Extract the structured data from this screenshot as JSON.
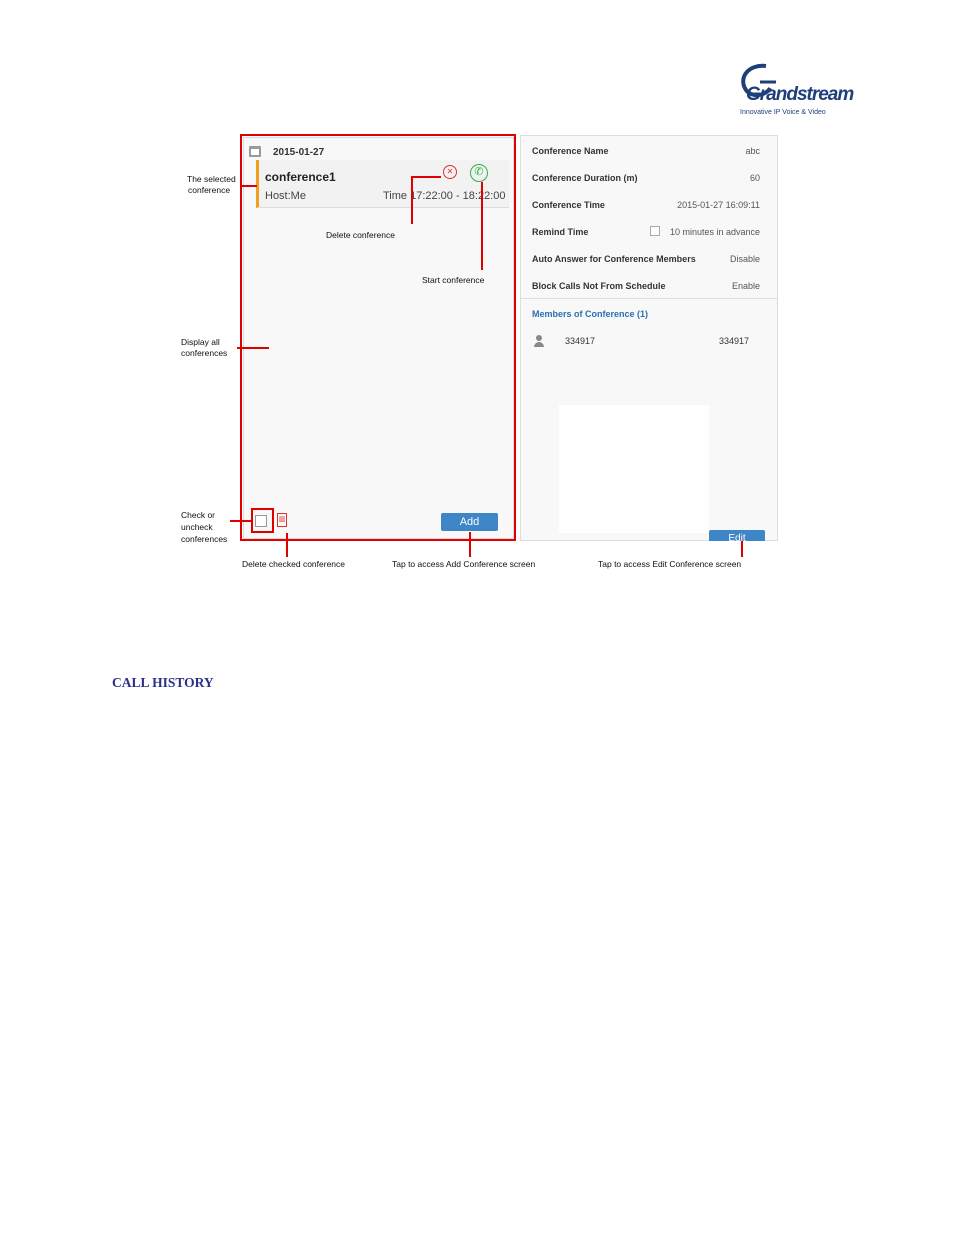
{
  "logo": {
    "word": "Grandstream",
    "tagline": "Innovative IP Voice & Video"
  },
  "list_panel": {
    "date": "2015-01-27",
    "conference": {
      "name": "conference1",
      "host": "Host:Me",
      "time": "Time 17:22:00 - 18:22:00"
    },
    "add_label": "Add"
  },
  "detail_panel": {
    "rows": [
      {
        "label": "Conference Name",
        "value": "abc"
      },
      {
        "label": "Conference Duration (m)",
        "value": "60"
      },
      {
        "label": "Conference Time",
        "value": "2015-01-27 16:09:11"
      },
      {
        "label": "Remind Time",
        "value": "10 minutes in advance"
      },
      {
        "label": "Auto Answer for Conference Members",
        "value": "Disable"
      },
      {
        "label": "Block Calls Not From Schedule",
        "value": "Enable"
      }
    ],
    "members_title": "Members of Conference (1)",
    "member": {
      "name": "334917",
      "number": "334917"
    },
    "edit_label": "Edit"
  },
  "annotations": {
    "selected_line1": "The selected",
    "selected_line2": "conference",
    "delete_conf": "Delete  conference",
    "start_conf": "Start  conference",
    "display_line1": "Display  all",
    "display_line2": "conferences",
    "check_line1": "Check  or",
    "check_line2": "uncheck",
    "check_line3": "conferences",
    "delete_checked": "Delete  checked conference",
    "tap_add": "Tap to access Add Conference screen",
    "tap_edit": "Tap to access Edit  Conference  screen"
  },
  "section_heading": "CALL HISTORY",
  "colors": {
    "annotation_red": "#e00000",
    "button_blue": "#3f86c6",
    "heading_navy": "#2b2f8a"
  }
}
